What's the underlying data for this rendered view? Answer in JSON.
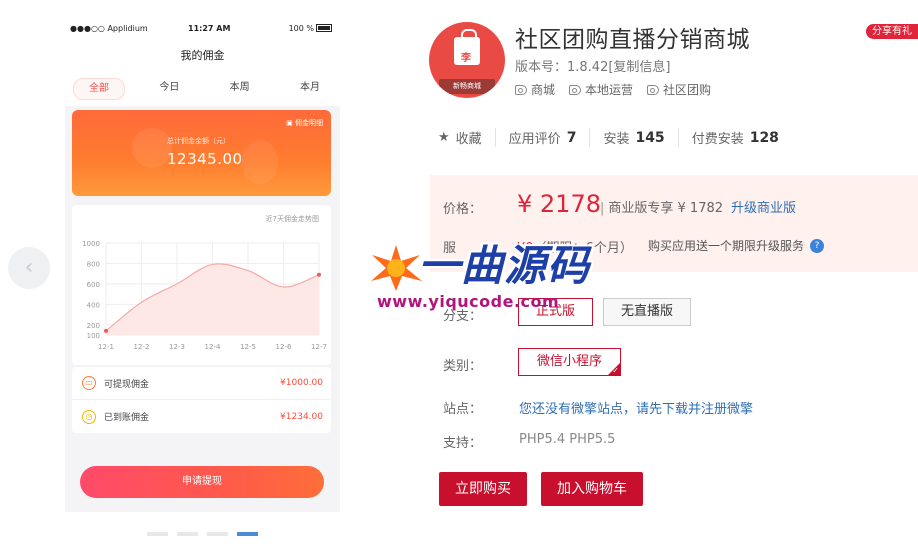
{
  "phone": {
    "status": {
      "carrier": "●●●○○ Applidium",
      "time": "11:27 AM",
      "battery": "100 %"
    },
    "title": "我的佣金",
    "tabs": [
      "全部",
      "今日",
      "本周",
      "本月"
    ],
    "active_tab": 0,
    "card": {
      "detail_link": "佣金明细",
      "total_label": "总计佣金金额（元）",
      "total_value": "12345.00"
    },
    "list": [
      {
        "label": "可提现佣金",
        "amount": "¥1000.00",
        "icon": "wallet-icon"
      },
      {
        "label": "已到账佣金",
        "amount": "¥1234.00",
        "icon": "clock-icon"
      }
    ],
    "withdraw_button": "申请提现",
    "carousel_pages": 4,
    "carousel_active": 3
  },
  "chart_data": {
    "type": "line",
    "title": "近7天佣金走势图",
    "categories": [
      "12-1",
      "12-2",
      "12-3",
      "12-4",
      "12-5",
      "12-6",
      "12-7"
    ],
    "values": [
      140,
      420,
      600,
      790,
      730,
      570,
      690
    ],
    "yticks": [
      100,
      200,
      400,
      600,
      800,
      1000
    ],
    "ylim": [
      100,
      1000
    ],
    "grid": true,
    "color": "#f4a9a8"
  },
  "product": {
    "title": "社区团购直播分销商城",
    "share_badge": "分享有礼",
    "logo_char": "李",
    "logo_text": "新畅商城",
    "version": "版本号：1.8.42[复制信息]",
    "tags": [
      "商城",
      "本地运营",
      "社区团购"
    ],
    "stats": {
      "favorite": "收藏",
      "rating_label": "应用评价",
      "rating_count": "7",
      "install_label": "安装",
      "install_count": "145",
      "paid_label": "付费安装",
      "paid_count": "128"
    },
    "price_label": "价格：",
    "price": "¥ 2178",
    "commercial": "商业版专享 ¥ 1782",
    "upgrade_link": "升级商业版",
    "term_label": "服",
    "term_value": "¥0",
    "term_period": "（期限：6个月）",
    "service_text": "购买应用送一个期限升级服务",
    "branch_label": "分支：",
    "branches": [
      "正式版",
      "无直播版"
    ],
    "category_label": "类别：",
    "category": "微信小程序",
    "site_label": "站点：",
    "site_link": "您还没有微擎站点，请先下载并注册微擎",
    "support_label": "支持：",
    "support": "PHP5.4   PHP5.5",
    "buy_button": "立即购买",
    "cart_button": "加入购物车",
    "colors": {
      "accent": "#c8102e",
      "link": "#2f6fb6",
      "price_bg": "#fff1ee"
    }
  },
  "watermark": {
    "title": "一曲源码",
    "url": "www.yiqucode.com"
  }
}
